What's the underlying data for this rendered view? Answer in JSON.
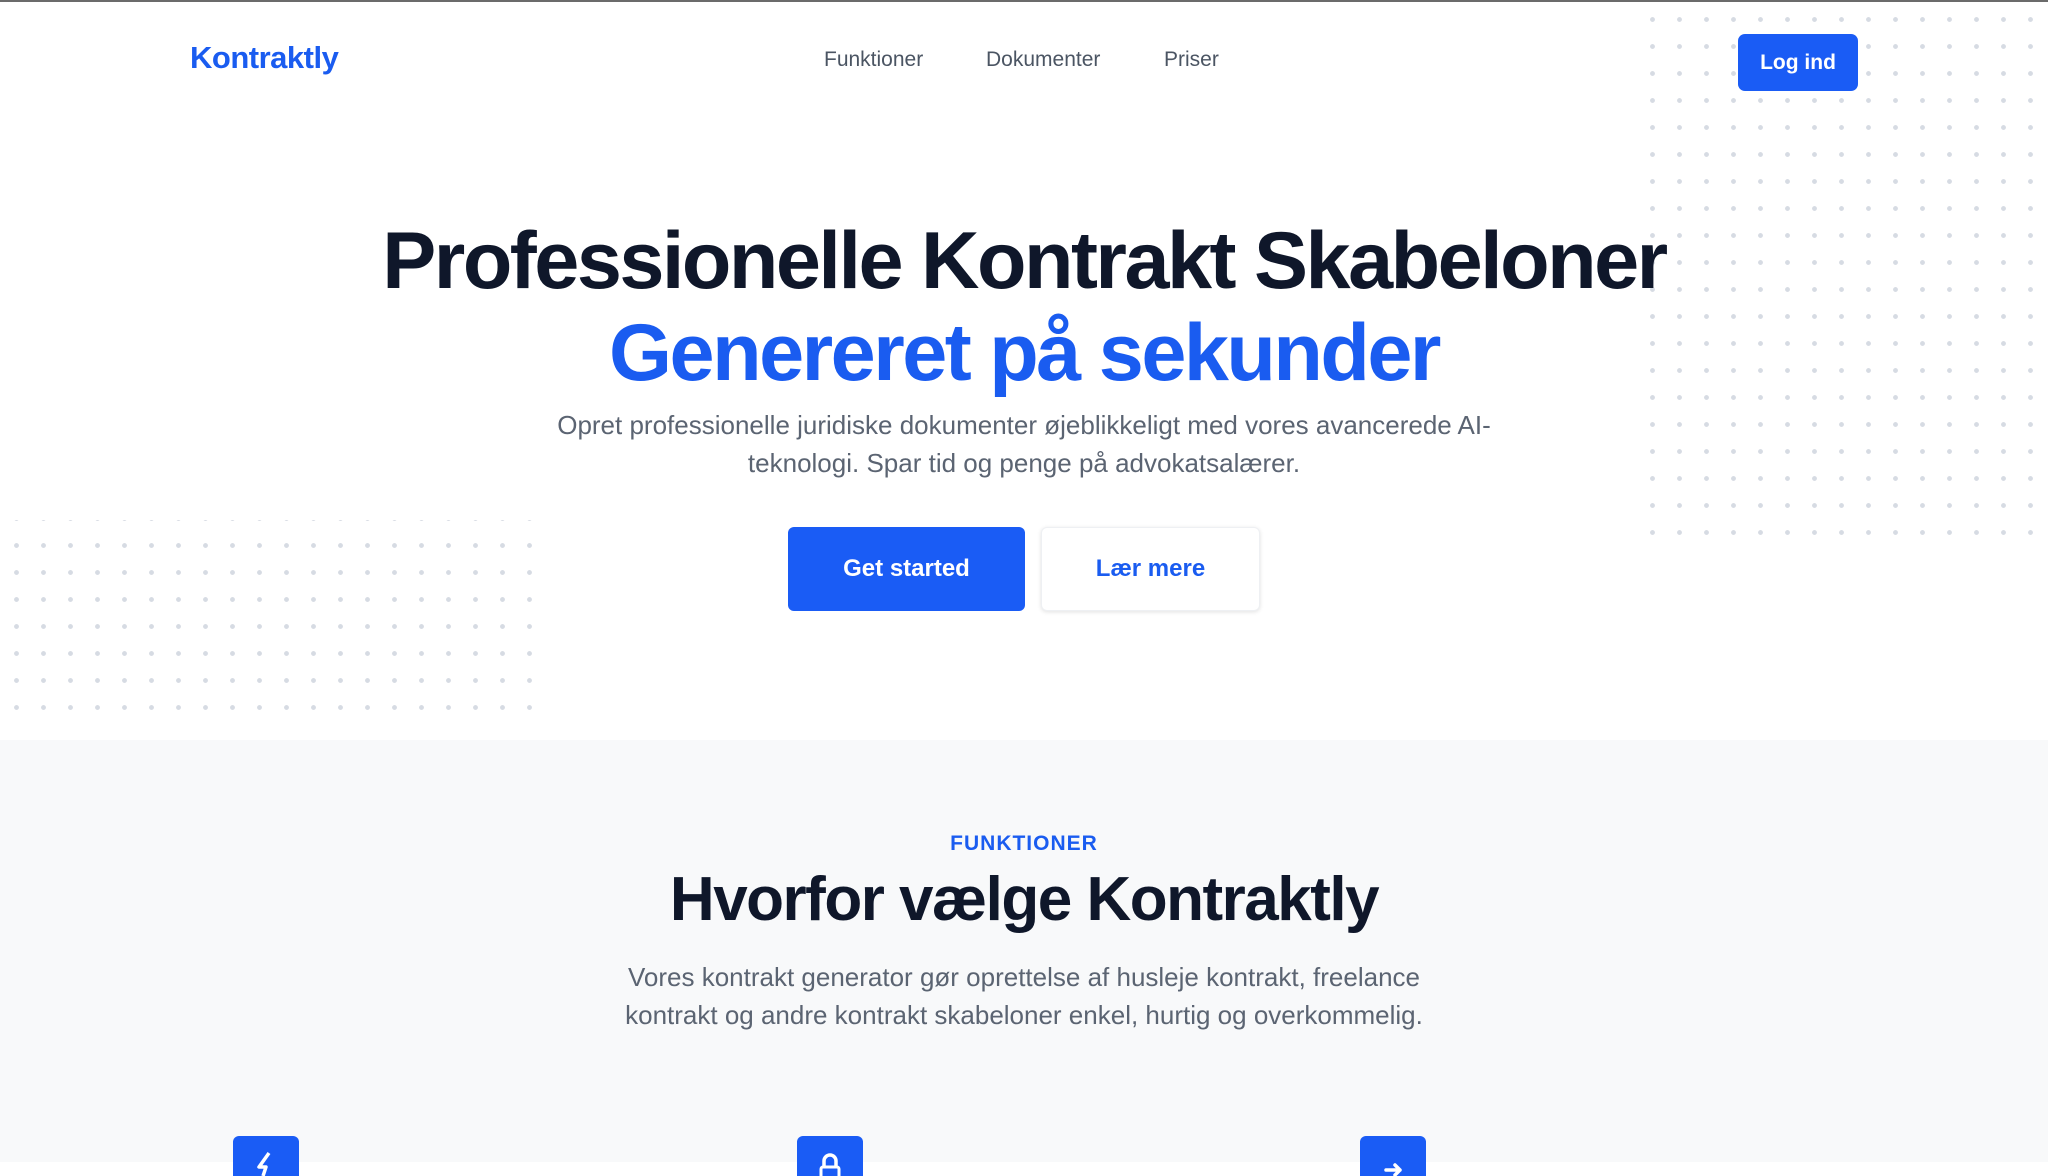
{
  "brand": {
    "name": "Kontraktly",
    "accent_color": "#1a5cf0"
  },
  "nav": {
    "items": [
      {
        "label": "Funktioner"
      },
      {
        "label": "Dokumenter"
      },
      {
        "label": "Priser"
      }
    ],
    "login_label": "Log ind"
  },
  "hero": {
    "title_line1": "Professionelle Kontrakt Skabeloner",
    "title_line2": "Genereret på sekunder",
    "subtitle": "Opret professionelle juridiske dokumenter øjeblikkeligt med vores avancerede AI-teknologi. Spar tid og penge på advokatsalærer.",
    "primary_cta": "Get started",
    "secondary_cta": "Lær mere"
  },
  "features": {
    "eyebrow": "FUNKTIONER",
    "title": "Hvorfor vælge Kontraktly",
    "subtitle": "Vores kontrakt generator gør oprettelse af husleje kontrakt, freelance kontrakt og andre kontrakt skabeloner enkel, hurtig og overkommelig.",
    "icons": [
      "lightning-icon",
      "lock-icon",
      "arrow-icon"
    ]
  }
}
